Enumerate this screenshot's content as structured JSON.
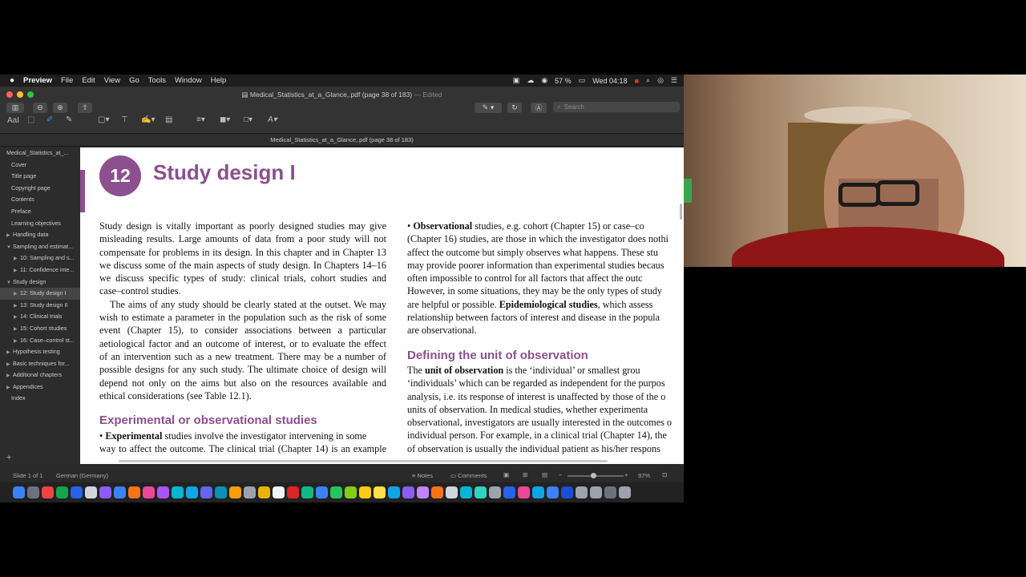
{
  "menubar": {
    "app": "Preview",
    "items": [
      "File",
      "Edit",
      "View",
      "Go",
      "Tools",
      "Window",
      "Help"
    ],
    "battery": "57 %",
    "clock": "Wed 04:18"
  },
  "window": {
    "title": "Medical_Statistics_at_a_Glance,.pdf (page 38 of 183)",
    "edited": "— Edited",
    "search_placeholder": "Search",
    "doc_title": "Medical_Statistics_at_a_Glance,.pdf (page 38 of 183)"
  },
  "sidebar": {
    "items": [
      {
        "label": "Medical_Statistics_at_...",
        "tri": "",
        "indent": 8,
        "selected": false
      },
      {
        "label": "Cover",
        "tri": "",
        "indent": 14,
        "selected": false
      },
      {
        "label": "Title page",
        "tri": "",
        "indent": 14,
        "selected": false
      },
      {
        "label": "Copyright page",
        "tri": "",
        "indent": 14,
        "selected": false
      },
      {
        "label": "Contents",
        "tri": "",
        "indent": 14,
        "selected": false
      },
      {
        "label": "Preface",
        "tri": "",
        "indent": 14,
        "selected": false
      },
      {
        "label": "Learning objectives",
        "tri": "",
        "indent": 14,
        "selected": false
      },
      {
        "label": "Handling data",
        "tri": "▶",
        "indent": 6,
        "selected": false
      },
      {
        "label": "Sampling and estimat...",
        "tri": "▼",
        "indent": 6,
        "selected": false
      },
      {
        "label": "10: Sampling and s...",
        "tri": "▶",
        "indent": 15,
        "selected": false
      },
      {
        "label": "11: Confidence inte...",
        "tri": "▶",
        "indent": 15,
        "selected": false
      },
      {
        "label": "Study design",
        "tri": "▼",
        "indent": 6,
        "selected": false
      },
      {
        "label": "12: Study design I",
        "tri": "▶",
        "indent": 15,
        "selected": true
      },
      {
        "label": "13: Study design II",
        "tri": "▶",
        "indent": 15,
        "selected": false
      },
      {
        "label": "14: Clinical trials",
        "tri": "▶",
        "indent": 15,
        "selected": false
      },
      {
        "label": "15: Cohort studies",
        "tri": "▶",
        "indent": 15,
        "selected": false
      },
      {
        "label": "16: Case–control st...",
        "tri": "▶",
        "indent": 15,
        "selected": false
      },
      {
        "label": "Hypothesis testing",
        "tri": "▶",
        "indent": 6,
        "selected": false
      },
      {
        "label": "Basic techniques for...",
        "tri": "▶",
        "indent": 6,
        "selected": false
      },
      {
        "label": "Additional chapters",
        "tri": "▶",
        "indent": 6,
        "selected": false
      },
      {
        "label": "Appendices",
        "tri": "▶",
        "indent": 6,
        "selected": false
      },
      {
        "label": "Index",
        "tri": "",
        "indent": 14,
        "selected": false
      }
    ]
  },
  "page": {
    "chapter_number": "12",
    "chapter_title": "Study design I",
    "left_para1_lines": [
      "Study design is vitally important as poorly designed studies may give",
      "misleading results. Large amounts of data from a poor study will not",
      "compensate for problems in its design. In this chapter and in Chapter 13",
      "we discuss some of the main aspects of study design. In Chapters 14–16",
      "we discuss specific types of study: clinical trials, cohort studies and",
      "case–control studies."
    ],
    "left_para2_lines": [
      "The aims of any study should be clearly stated at the outset. We may",
      "wish to estimate a parameter in the population such as the risk of some",
      "event (Chapter 15), to consider associations between a particular",
      "aetiological factor and an outcome of interest, or to evaluate the effect",
      "of an intervention such as a new treatment. There may be a number of",
      "possible designs for any such study. The ultimate choice of design will",
      "depend not only on the aims but also on the resources available and",
      "ethical considerations (see Table 12.1)."
    ],
    "left_heading": "Experimental or observational studies",
    "left_para3_bold": "Experimental",
    "left_para3_rest": " studies involve the investigator intervening in some",
    "left_para3_line2": "way to affect the outcome. The clinical trial (Chapter 14) is an example",
    "right_para1_bold": "Observational",
    "right_para1_first_rest": " studies, e.g. cohort (Chapter 15) or case–co",
    "right_para1_lines": [
      "(Chapter 16) studies, are those in which the investigator does nothi",
      "affect the outcome but simply observes what happens. These stu",
      "may provide poorer information than experimental studies becaus",
      "often impossible to control for all factors that affect the outc",
      "However, in some situations, they may be the only types of study"
    ],
    "right_para1_epi_pre": "are helpful or possible. ",
    "right_para1_epi_bold": "Epidemiological studies",
    "right_para1_epi_post": ", which assess",
    "right_para1_lines2": [
      "relationship between factors of interest and disease in the popula",
      "are observational."
    ],
    "right_heading": "Defining the unit of observation",
    "right_para2_pre": "The ",
    "right_para2_bold": "unit of observation",
    "right_para2_post": " is the ‘individual’ or smallest grou",
    "right_para2_lines": [
      "‘individuals’ which can be regarded as independent for the purpos",
      "analysis, i.e. its response of interest is unaffected by those of the o",
      "units of observation. In medical studies, whether experimenta",
      "observational, investigators are usually interested in the outcomes o",
      "individual person. For example, in a clinical trial (Chapter 14), the",
      "of observation is usually the individual patient as his/her respons"
    ]
  },
  "statusbar": {
    "slide": "Slide 1 of 1",
    "language": "German (Germany)",
    "notes": "Notes",
    "comments": "Comments",
    "zoom": "97%"
  },
  "colors": {
    "accent": "#8c4f8f"
  }
}
